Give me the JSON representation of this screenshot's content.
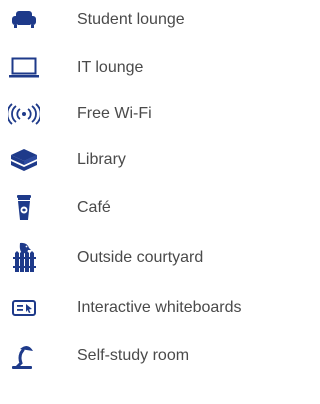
{
  "accent_color": "#1e3a8a",
  "facilities": [
    {
      "label": "Student lounge",
      "icon": "sofa-icon"
    },
    {
      "label": "IT lounge",
      "icon": "laptop-icon"
    },
    {
      "label": "Free Wi-Fi",
      "icon": "wifi-signal-icon"
    },
    {
      "label": "Library",
      "icon": "books-icon"
    },
    {
      "label": "Café",
      "icon": "coffee-cup-icon"
    },
    {
      "label": "Outside courtyard",
      "icon": "bird-on-fence-icon"
    },
    {
      "label": "Interactive whiteboards",
      "icon": "whiteboard-icon"
    },
    {
      "label": "Self-study room",
      "icon": "desk-lamp-icon"
    }
  ]
}
